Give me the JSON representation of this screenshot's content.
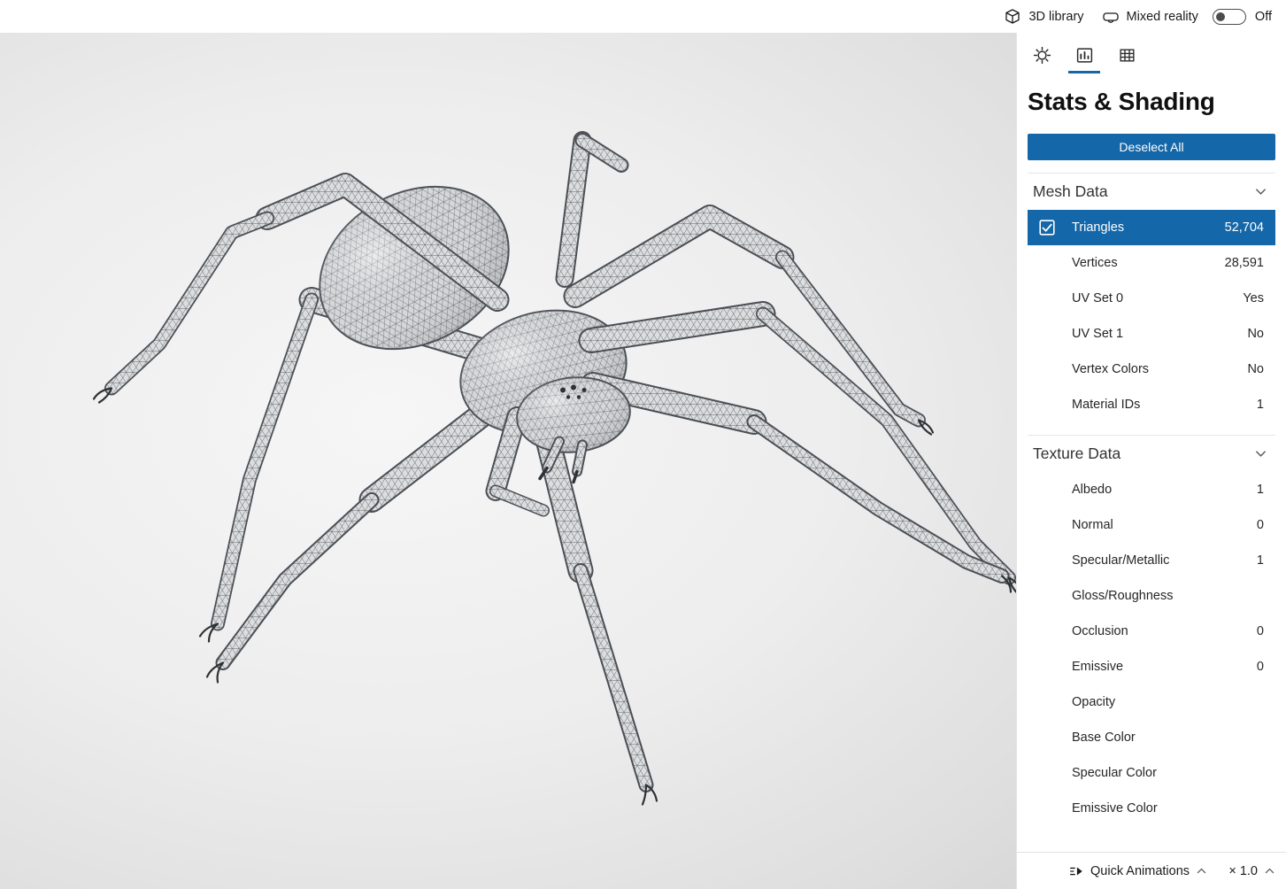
{
  "topbar": {
    "library_label": "3D library",
    "mixed_reality_label": "Mixed reality",
    "mixed_reality_state": "Off"
  },
  "panel": {
    "title": "Stats & Shading",
    "deselect_all_label": "Deselect All",
    "mesh_section": {
      "title": "Mesh Data",
      "rows": [
        {
          "label": "Triangles",
          "value": "52,704",
          "selected": true
        },
        {
          "label": "Vertices",
          "value": "28,591"
        },
        {
          "label": "UV Set 0",
          "value": "Yes"
        },
        {
          "label": "UV Set 1",
          "value": "No"
        },
        {
          "label": "Vertex Colors",
          "value": "No"
        },
        {
          "label": "Material IDs",
          "value": "1"
        }
      ]
    },
    "texture_section": {
      "title": "Texture Data",
      "rows": [
        {
          "label": "Albedo",
          "value": "1"
        },
        {
          "label": "Normal",
          "value": "0"
        },
        {
          "label": "Specular/Metallic",
          "value": "1"
        },
        {
          "label": "Gloss/Roughness",
          "value": ""
        },
        {
          "label": "Occlusion",
          "value": "0"
        },
        {
          "label": "Emissive",
          "value": "0"
        },
        {
          "label": "Opacity",
          "value": ""
        },
        {
          "label": "Base Color",
          "value": ""
        },
        {
          "label": "Specular Color",
          "value": ""
        },
        {
          "label": "Emissive Color",
          "value": ""
        }
      ]
    }
  },
  "bottombar": {
    "quick_animations_label": "Quick Animations",
    "playback_speed_label": "× 1.0"
  },
  "icons": {
    "topbar": [
      "cube-icon",
      "mixed-reality-icon"
    ],
    "tabs": [
      "lighting-sun-icon",
      "stats-chart-icon",
      "grid-icon"
    ],
    "sections": [
      "chevron-down-icon"
    ],
    "bottombar": [
      "quick-animations-icon",
      "chevron-up-icon"
    ]
  },
  "colors": {
    "accent": "#1467a8"
  }
}
